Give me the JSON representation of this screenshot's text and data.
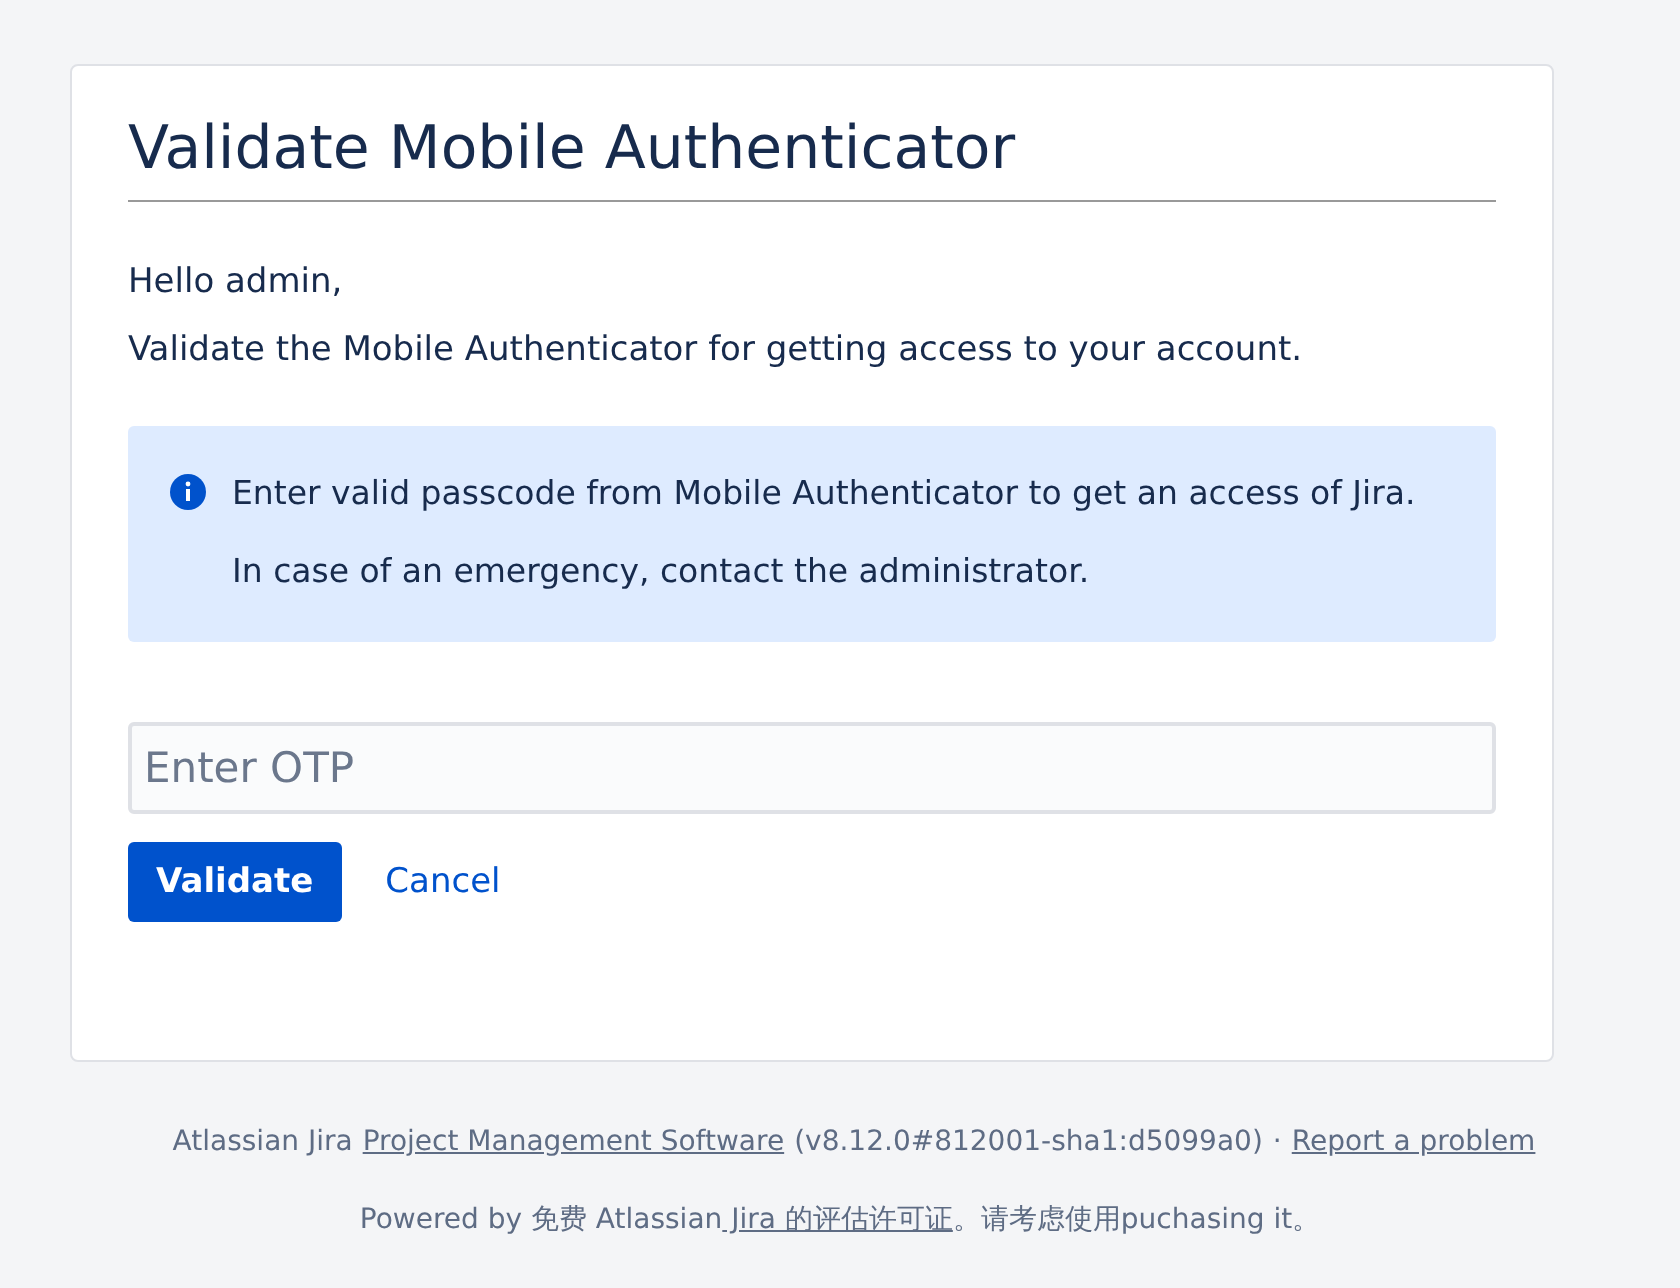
{
  "title": "Validate Mobile Authenticator",
  "greeting": "Hello admin,",
  "intro": "Validate the Mobile Authenticator for getting access to your account.",
  "info": {
    "kind": "info",
    "lines": [
      "Enter valid passcode from Mobile Authenticator to get an access of Jira.",
      "In case of an emergency, contact the administrator."
    ]
  },
  "otp_field": {
    "placeholder": "Enter OTP"
  },
  "buttons": [
    {
      "label": "Validate",
      "kind": "primary"
    },
    {
      "label": "Cancel",
      "kind": "link"
    }
  ],
  "footer": {
    "line_1": [
      {
        "kind": "text",
        "text": "Atlassian Jira"
      },
      {
        "kind": "link",
        "text": "Project Management Software"
      },
      {
        "kind": "text",
        "text": "(v8.12.0#812001-sha1:d5099a0)"
      },
      {
        "kind": "text",
        "text": "·"
      },
      {
        "kind": "link",
        "text": "Report a problem"
      }
    ],
    "line_2": {
      "before": "Powered by 免费 Atlassian",
      "link": " Jira 的评估许可证",
      "after": "。请考虑使用puchasing it。"
    }
  }
}
